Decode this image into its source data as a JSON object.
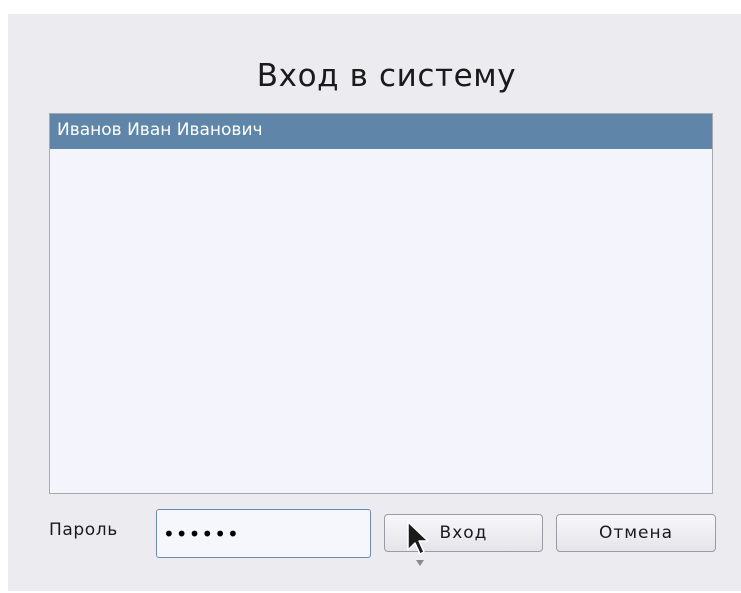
{
  "dialog": {
    "title": "Вход в систему"
  },
  "user_list": {
    "items": [
      {
        "label": "Иванов Иван Иванович",
        "selected": true
      }
    ]
  },
  "password": {
    "label": "Пароль",
    "value": "••••••"
  },
  "buttons": {
    "login_label": "Вход",
    "cancel_label": "Отмена"
  },
  "colors": {
    "dialog_background": "#ecebf0",
    "list_background": "#f4f4fc",
    "selection": "#5f86a8",
    "input_border": "#6d8db0"
  },
  "icons": {
    "pointer": "arrow-cursor-icon"
  }
}
